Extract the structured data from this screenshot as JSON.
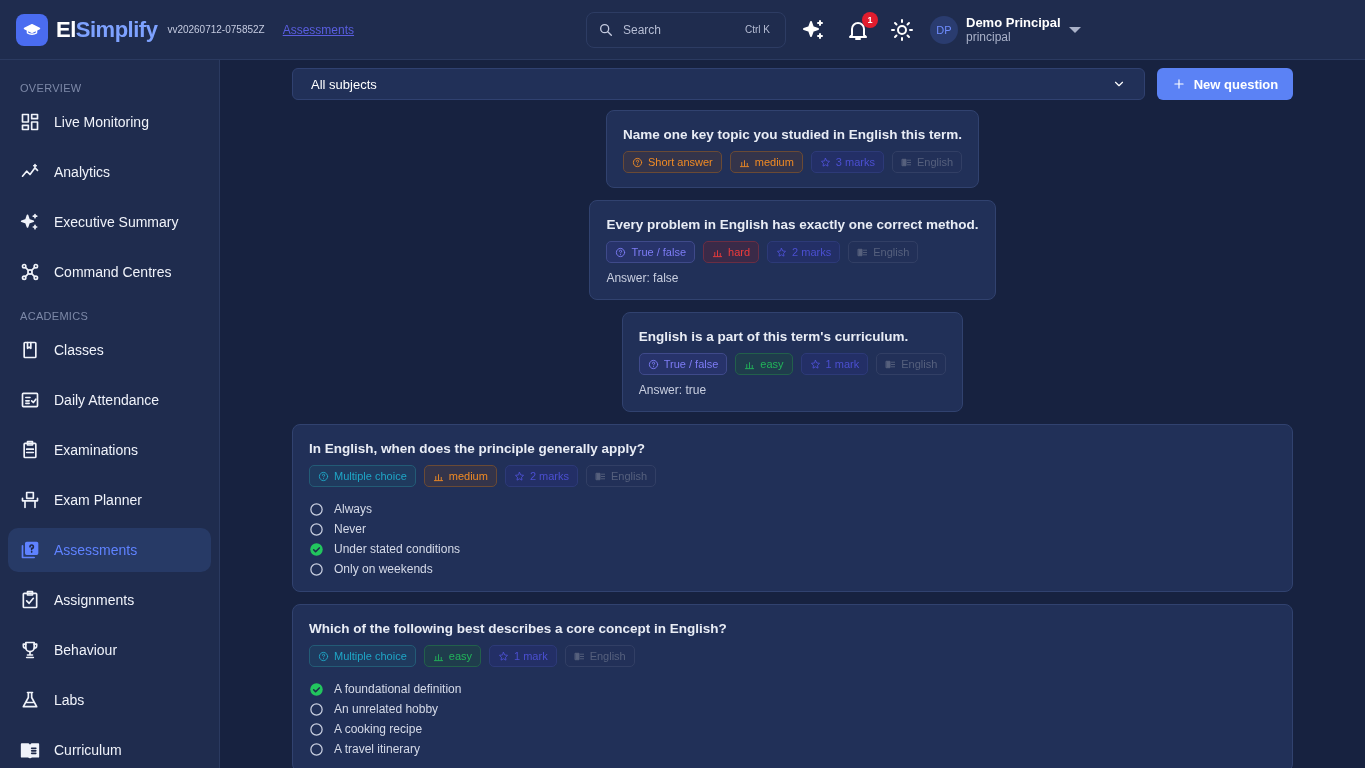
{
  "header": {
    "logo_first": "El",
    "logo_second": "Simplify",
    "version": "vv20260712-075852Z",
    "breadcrumb": "Assessments",
    "search": {
      "placeholder": "Search",
      "shortcut": "Ctrl K"
    },
    "notifications": "1",
    "user": {
      "initials": "DP",
      "name": "Demo Principal",
      "role": "principal"
    }
  },
  "sidebar": {
    "sections": [
      {
        "title": "OVERVIEW",
        "items": [
          {
            "label": "Live Monitoring",
            "selected": false
          },
          {
            "label": "Analytics",
            "selected": false
          },
          {
            "label": "Executive Summary",
            "selected": false
          },
          {
            "label": "Command Centres",
            "selected": false
          }
        ]
      },
      {
        "title": "ACADEMICS",
        "items": [
          {
            "label": "Classes",
            "selected": false
          },
          {
            "label": "Daily Attendance",
            "selected": false
          },
          {
            "label": "Examinations",
            "selected": false
          },
          {
            "label": "Exam Planner",
            "selected": false
          },
          {
            "label": "Assessments",
            "selected": true
          },
          {
            "label": "Assignments",
            "selected": false
          },
          {
            "label": "Behaviour",
            "selected": false
          },
          {
            "label": "Labs",
            "selected": false
          },
          {
            "label": "Curriculum",
            "selected": false
          }
        ]
      }
    ]
  },
  "filter": {
    "subject": "All subjects",
    "button": "New question"
  },
  "questions": [
    {
      "kind": "short",
      "text": "Name one key topic you studied in English this term.",
      "type": "Short answer",
      "difficulty": "medium",
      "marks": "3 marks",
      "subject": "English"
    },
    {
      "kind": "truefalse",
      "text": "Every problem in English has exactly one correct method.",
      "type": "True / false",
      "difficulty": "hard",
      "marks": "2 marks",
      "subject": "English",
      "answer": "Answer: false"
    },
    {
      "kind": "truefalse",
      "text": "English is a part of this term's curriculum.",
      "type": "True / false",
      "difficulty": "easy",
      "marks": "1 mark",
      "subject": "English",
      "answer": "Answer: true"
    },
    {
      "kind": "mcq",
      "text": "In English, when does the principle generally apply?",
      "type": "Multiple choice",
      "difficulty": "medium",
      "marks": "2 marks",
      "subject": "English",
      "options": [
        {
          "label": "Always",
          "correct": false
        },
        {
          "label": "Never",
          "correct": false
        },
        {
          "label": "Under stated conditions",
          "correct": true
        },
        {
          "label": "Only on weekends",
          "correct": false
        }
      ]
    },
    {
      "kind": "mcq",
      "text": "Which of the following best describes a core concept in English?",
      "type": "Multiple choice",
      "difficulty": "easy",
      "marks": "1 mark",
      "subject": "English",
      "options": [
        {
          "label": "A foundational definition",
          "correct": true
        },
        {
          "label": "An unrelated hobby",
          "correct": false
        },
        {
          "label": "A cooking recipe",
          "correct": false
        },
        {
          "label": "A travel itinerary",
          "correct": false
        }
      ]
    }
  ]
}
